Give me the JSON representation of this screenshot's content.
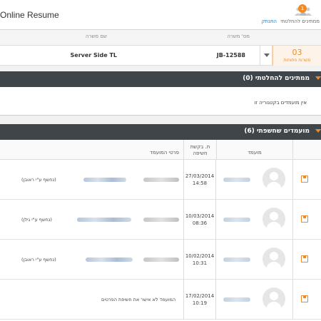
{
  "header": {
    "app_title": "Online Resume",
    "notification_count": "1",
    "waiting_label": "ממתינים להחלטתי",
    "logout_label": "התנתק"
  },
  "job": {
    "col_job_no": "מס' משרה",
    "col_job_name": "שם משרה",
    "job_no": "JB-12588",
    "job_name": "Server Side TL",
    "open_count": "03",
    "open_label": "משרות פתוחות"
  },
  "pending_section": {
    "title": "ממתינים להחלטתי (0)",
    "empty_message": "אין מועמדים בקטגוריה זו"
  },
  "exposed_section": {
    "title": "מועמדים שחשפתי (6)",
    "columns": {
      "candidate": "מועמד",
      "request_date_line1": "ת. בקשת",
      "request_date_line2": "חשיפה",
      "details": "פרטי המועמד"
    },
    "rows": [
      {
        "date": "27/03/2014",
        "time": "14:58",
        "note": "(נחשף ע\"י ראובן)"
      },
      {
        "date": "10/03/2014",
        "time": "08:36",
        "note": "(נחשף ע\"י גילן)"
      },
      {
        "date": "10/02/2014",
        "time": "10:31",
        "note": "(נחשף ע\"י ראובן)"
      },
      {
        "date": "17/02/2014",
        "time": "10:19",
        "note": "המועמד לא אישר את חשיפת הפרטים"
      }
    ]
  },
  "colors": {
    "accent": "#f08a24",
    "section_bar": "#3f4549",
    "link": "#2a7ab0"
  },
  "icons": {
    "user_group": "users-icon",
    "save": "save-icon",
    "avatar": "avatar-placeholder-icon",
    "dropdown": "chevron-down-icon"
  }
}
